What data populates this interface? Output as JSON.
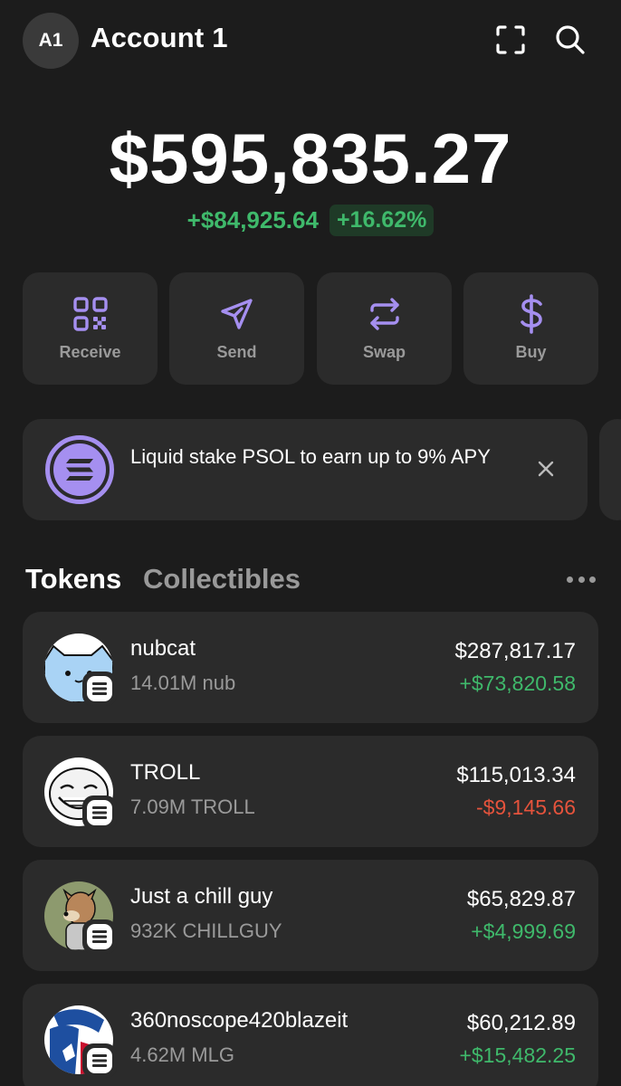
{
  "header": {
    "avatar_initials": "A1",
    "account_name": "Account 1",
    "icons": [
      "scan-icon",
      "search-icon"
    ]
  },
  "balance": {
    "total": "$595,835.27",
    "change_amount": "+$84,925.64",
    "change_percent": "+16.62%"
  },
  "actions": [
    {
      "label": "Receive",
      "icon": "qr-code-icon"
    },
    {
      "label": "Send",
      "icon": "send-icon"
    },
    {
      "label": "Swap",
      "icon": "swap-icon"
    },
    {
      "label": "Buy",
      "icon": "dollar-icon"
    }
  ],
  "promo": {
    "text": "Liquid stake PSOL to earn up to 9% APY",
    "icon": "solana-logo-icon"
  },
  "tabs": {
    "tokens": "Tokens",
    "collectibles": "Collectibles"
  },
  "tokens": [
    {
      "name": "nubcat",
      "amount": "14.01M nub",
      "value": "$287,817.17",
      "change": "+$73,820.58",
      "direction": "up"
    },
    {
      "name": "TROLL",
      "amount": "7.09M TROLL",
      "value": "$115,013.34",
      "change": "-$9,145.66",
      "direction": "down"
    },
    {
      "name": "Just a chill guy",
      "amount": "932K CHILLGUY",
      "value": "$65,829.87",
      "change": "+$4,999.69",
      "direction": "up"
    },
    {
      "name": "360noscope420blazeit",
      "amount": "4.62M MLG",
      "value": "$60,212.89",
      "change": "+$15,482.25",
      "direction": "up"
    }
  ],
  "colors": {
    "background": "#1c1c1c",
    "card": "#2b2b2b",
    "accent": "#a58ff0",
    "positive": "#3fb96b",
    "negative": "#e5533c"
  }
}
